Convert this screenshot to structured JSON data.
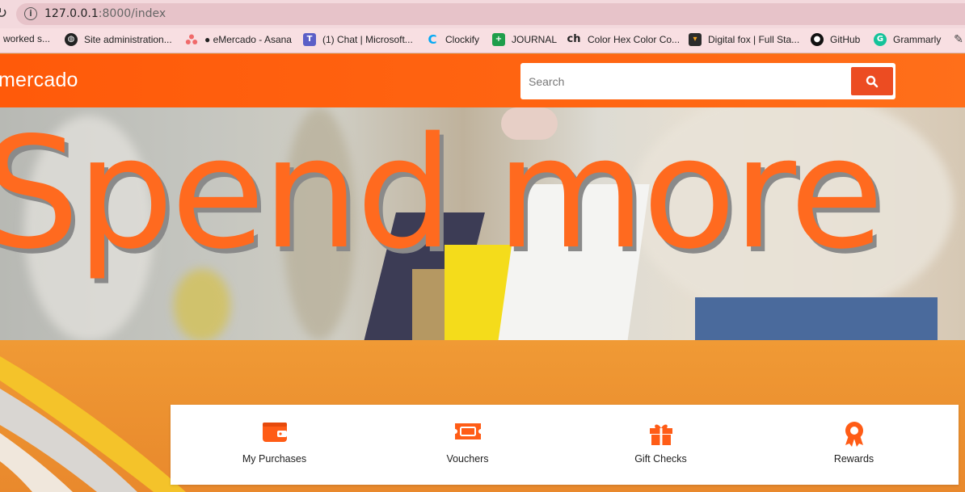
{
  "browser": {
    "url_host": "127.0.0.1",
    "url_rest": ":8000/index",
    "bookmarks": [
      {
        "label": "l worked s...",
        "icon": "none"
      },
      {
        "label": "Site administration...",
        "icon": "globe-icon"
      },
      {
        "label": "● eMercado - Asana",
        "icon": "asana-icon"
      },
      {
        "label": "(1) Chat | Microsoft...",
        "icon": "teams-icon"
      },
      {
        "label": "Clockify",
        "icon": "clockify-icon"
      },
      {
        "label": "JOURNAL",
        "icon": "sheets-icon"
      },
      {
        "label": "Color Hex Color Co...",
        "icon": "colorhex-icon"
      },
      {
        "label": "Digital fox | Full Sta...",
        "icon": "digitalfox-icon"
      },
      {
        "label": "GitHub",
        "icon": "github-icon"
      },
      {
        "label": "Grammarly",
        "icon": "grammarly-icon"
      }
    ]
  },
  "header": {
    "logo": "mercado",
    "search_placeholder": "Search",
    "accent": "#ff5a0a"
  },
  "hero": {
    "headline": "Spend more"
  },
  "categories": [
    {
      "label": "My Purchases",
      "icon": "wallet-icon"
    },
    {
      "label": "Vouchers",
      "icon": "ticket-icon"
    },
    {
      "label": "Gift Checks",
      "icon": "gift-icon"
    },
    {
      "label": "Rewards",
      "icon": "award-icon"
    }
  ],
  "colors": {
    "brand_orange": "#ff6a1f",
    "search_button": "#ec4c22",
    "icon_orange": "#ff5c16"
  }
}
